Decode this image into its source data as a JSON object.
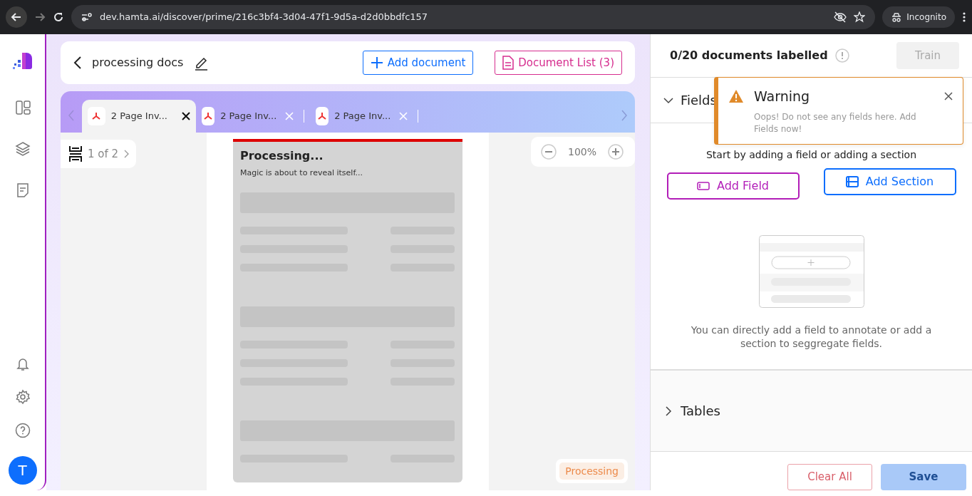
{
  "browser": {
    "url": "dev.hamta.ai/discover/prime/216c3bf4-3d04-47f1-9d5a-d2d0bbdfc157",
    "profile": "Incognito"
  },
  "sidebar": {
    "avatar": "T"
  },
  "header": {
    "title": "processing docs",
    "add_document": "Add document",
    "document_list": "Document List (3)"
  },
  "tabs": [
    {
      "label": "2 Page Inv...",
      "selected": true
    },
    {
      "label": "2 Page Inv...",
      "selected": false
    },
    {
      "label": "2 Page Inv...",
      "selected": false
    }
  ],
  "viewer": {
    "pager": "1 of 2",
    "doc_title": "Processing...",
    "doc_subtitle": "Magic is about to reveal itself...",
    "zoom": "100%",
    "status": "Processing"
  },
  "panel": {
    "count": "0/20 documents labelled",
    "train": {
      "label": "Train",
      "disabled": true
    },
    "sections": [
      {
        "title": "Fields",
        "expanded": true
      },
      {
        "title": "Tables",
        "expanded": false
      }
    ],
    "intro": "Start by adding a field or adding a section",
    "add_field": "Add Field",
    "add_section": "Add Section",
    "hint": "You can directly add a field to annotate or add a section to seggregate fields.",
    "clear_all": {
      "label": "Clear All",
      "disabled": true
    },
    "save": {
      "label": "Save",
      "disabled": true
    }
  },
  "toast": {
    "title": "Warning",
    "message": "Oops! Do not see any fields here. Add Fields now!"
  }
}
